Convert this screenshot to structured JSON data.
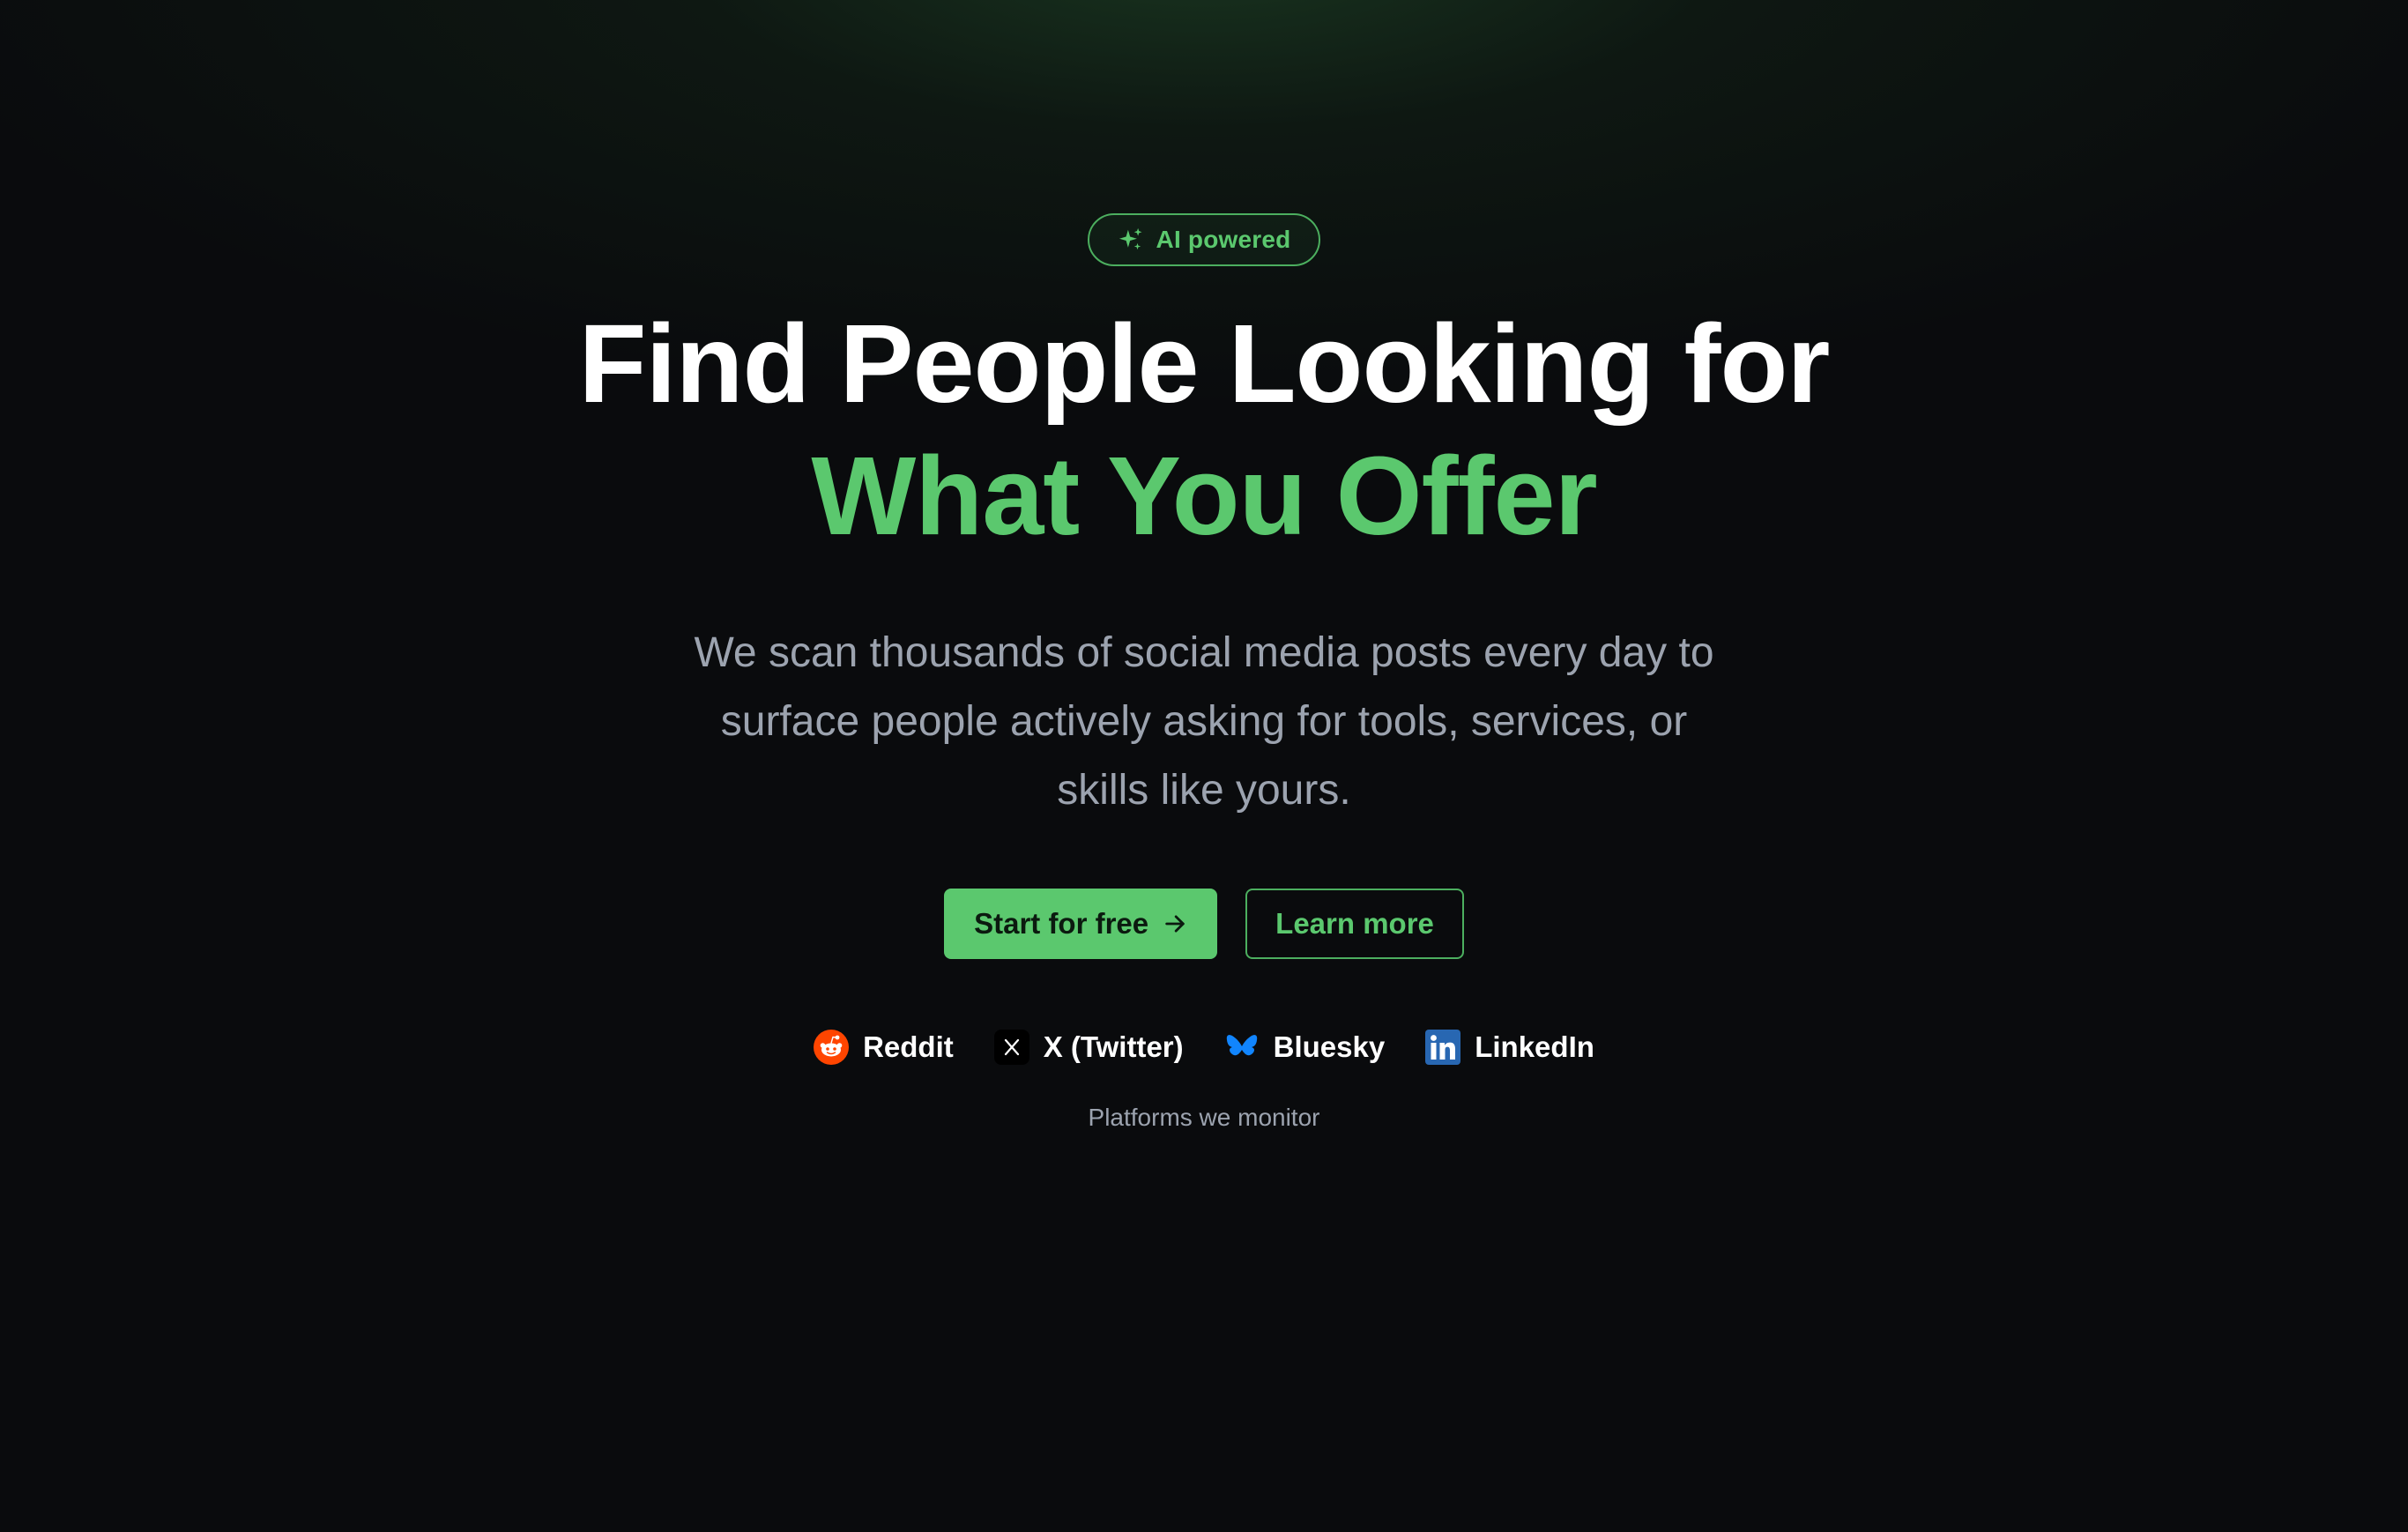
{
  "badge": {
    "icon": "sparkles-icon",
    "label": "AI powered"
  },
  "headline": {
    "line1": "Find People Looking for",
    "line2": "What You Offer"
  },
  "subtitle": "We scan thousands of social media posts every day to surface people actively asking for tools, services, or skills like yours.",
  "cta": {
    "primary_label": "Start for free",
    "primary_icon": "arrow-right-icon",
    "secondary_label": "Learn more"
  },
  "platforms": {
    "items": [
      {
        "name": "Reddit",
        "icon": "reddit-icon"
      },
      {
        "name": "X (Twitter)",
        "icon": "x-icon"
      },
      {
        "name": "Bluesky",
        "icon": "bluesky-icon"
      },
      {
        "name": "LinkedIn",
        "icon": "linkedin-icon"
      }
    ],
    "caption": "Platforms we monitor"
  },
  "colors": {
    "accent": "#5bc86e",
    "background": "#0a0b0d",
    "text_primary": "#ffffff",
    "text_muted": "#9ca3af",
    "reddit": "#ff4500",
    "bluesky": "#1185fe",
    "linkedin": "#2867b2"
  }
}
